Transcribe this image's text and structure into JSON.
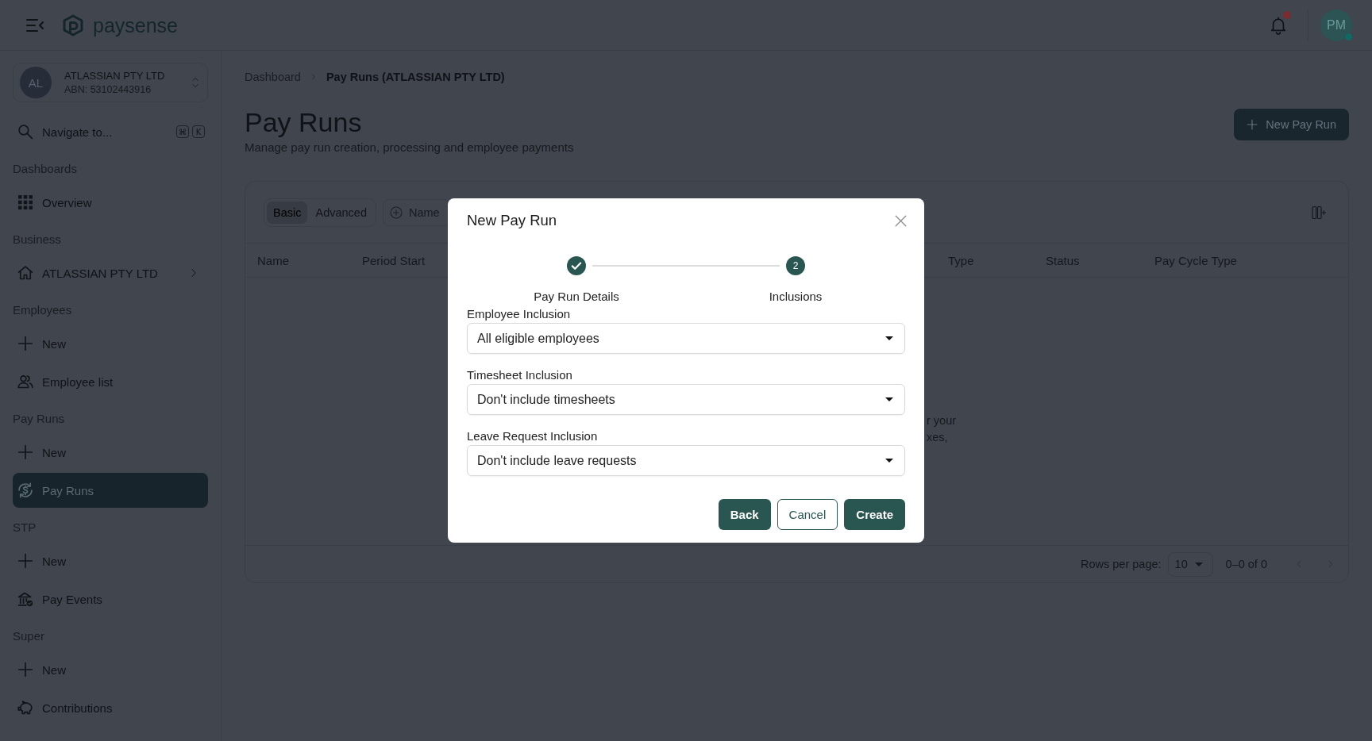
{
  "header": {
    "logo_text": "paysense",
    "notifications": {
      "unread": true
    },
    "user": {
      "initials": "PM",
      "online": true
    }
  },
  "sidebar": {
    "organization": {
      "initials": "AL",
      "name": "ATLASSIAN PTY LTD",
      "abn": "ABN: 53102443916"
    },
    "navigate": {
      "label": "Navigate to...",
      "shortcut_keys": [
        "⌘",
        "K"
      ]
    },
    "sections": [
      {
        "title": "Dashboards",
        "items": [
          {
            "kind": "overview",
            "label": "Overview",
            "selected": false
          }
        ]
      },
      {
        "title": "Business",
        "items": [
          {
            "kind": "organization",
            "label": "ATLASSIAN PTY LTD",
            "selected": false
          }
        ]
      },
      {
        "title": "Employees",
        "items": [
          {
            "kind": "new",
            "label": "New",
            "selected": false
          },
          {
            "kind": "list",
            "label": "Employee list",
            "selected": false
          }
        ]
      },
      {
        "title": "Pay Runs",
        "items": [
          {
            "kind": "new",
            "label": "New",
            "selected": false
          },
          {
            "kind": "payruns",
            "label": "Pay Runs",
            "selected": true
          }
        ]
      },
      {
        "title": "STP",
        "items": [
          {
            "kind": "new",
            "label": "New",
            "selected": false
          },
          {
            "kind": "events",
            "label": "Pay Events",
            "selected": false
          }
        ]
      },
      {
        "title": "Super",
        "items": [
          {
            "kind": "new",
            "label": "New",
            "selected": false
          },
          {
            "kind": "contributions",
            "label": "Contributions",
            "selected": false
          }
        ]
      }
    ]
  },
  "page": {
    "breadcrumb": [
      {
        "label": "Dashboard",
        "current": false
      },
      {
        "label": "Pay Runs (ATLASSIAN PTY LTD)",
        "current": true
      }
    ],
    "title": "Pay Runs",
    "subtitle": "Manage pay run creation, processing and employee payments",
    "new_button": "New Pay Run"
  },
  "table": {
    "views": [
      {
        "label": "Basic",
        "selected": true
      },
      {
        "label": "Advanced",
        "selected": false
      }
    ],
    "filters": [
      "Name"
    ],
    "columns": [
      "Name",
      "Period Start",
      "Type",
      "Status",
      "Pay Cycle Type"
    ],
    "empty_message_lines": [
      "r your",
      "xes,"
    ],
    "pagination": {
      "rows_per_page_label": "Rows per page:",
      "rows_per_page": "10",
      "range": "0–0 of 0",
      "page_buttons": [
        {
          "kind": "previous",
          "disabled": true
        },
        {
          "kind": "next",
          "disabled": true
        }
      ]
    }
  },
  "dialog": {
    "title": "New Pay Run",
    "steps": [
      {
        "label": "Pay Run Details",
        "completed": true
      },
      {
        "label": "Inclusions",
        "number": "2",
        "completed": false
      }
    ],
    "fields": [
      {
        "label": "Employee Inclusion",
        "value": "All eligible employees"
      },
      {
        "label": "Timesheet Inclusion",
        "value": "Don't include timesheets"
      },
      {
        "label": "Leave Request Inclusion",
        "value": "Don't include leave requests"
      }
    ],
    "buttons": [
      {
        "kind": "filled",
        "label": "Back"
      },
      {
        "kind": "outlined",
        "label": "Cancel"
      },
      {
        "kind": "filled",
        "label": "Create"
      }
    ]
  }
}
